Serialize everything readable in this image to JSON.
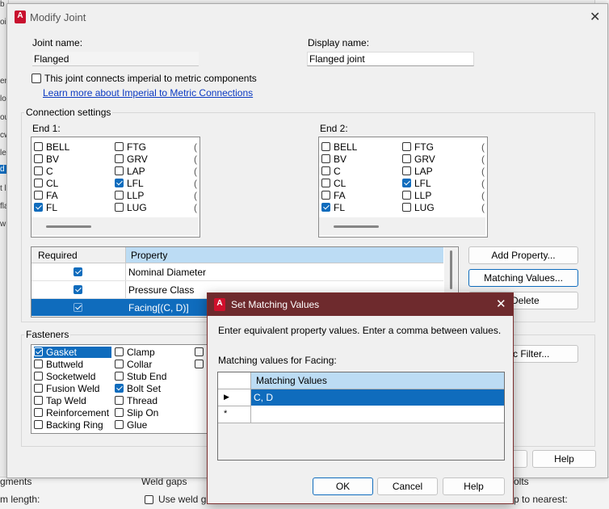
{
  "background": {
    "left_fragments": [
      "b",
      "oi",
      "er",
      "lo",
      "ou",
      "cw",
      "le",
      "d",
      "t l",
      "fla",
      "w"
    ],
    "bottom_texts": [
      "gments",
      "m length:",
      "Weld gaps",
      "Use weld ga",
      "olts",
      "p to nearest:"
    ]
  },
  "dialog": {
    "title": "Modify Joint",
    "joint_name_label": "Joint name:",
    "joint_name_value": "Flanged",
    "display_name_label": "Display name:",
    "display_name_value": "Flanged joint",
    "imperial_metric_label": "This joint connects imperial to metric components",
    "imperial_metric_checked": false,
    "learn_more_link": "Learn more about Imperial to Metric Connections",
    "connection_settings_title": "Connection settings",
    "end1_label": "End 1:",
    "end2_label": "End 2:",
    "end1_items": [
      {
        "label": "BELL",
        "checked": false
      },
      {
        "label": "BV",
        "checked": false
      },
      {
        "label": "C",
        "checked": false
      },
      {
        "label": "CL",
        "checked": false
      },
      {
        "label": "FA",
        "checked": false
      },
      {
        "label": "FL",
        "checked": true
      },
      {
        "label": "FTG",
        "checked": false
      },
      {
        "label": "GRV",
        "checked": false
      },
      {
        "label": "LAP",
        "checked": false
      },
      {
        "label": "LFL",
        "checked": true
      },
      {
        "label": "LLP",
        "checked": false
      },
      {
        "label": "LUG",
        "checked": false
      }
    ],
    "end2_items": [
      {
        "label": "BELL",
        "checked": false
      },
      {
        "label": "BV",
        "checked": false
      },
      {
        "label": "C",
        "checked": false
      },
      {
        "label": "CL",
        "checked": false
      },
      {
        "label": "FA",
        "checked": false
      },
      {
        "label": "FL",
        "checked": true
      },
      {
        "label": "FTG",
        "checked": false
      },
      {
        "label": "GRV",
        "checked": false
      },
      {
        "label": "LAP",
        "checked": false
      },
      {
        "label": "LFL",
        "checked": true
      },
      {
        "label": "LLP",
        "checked": false
      },
      {
        "label": "LUG",
        "checked": false
      }
    ],
    "property_grid": {
      "columns": [
        "Required",
        "Property"
      ],
      "rows": [
        {
          "required": true,
          "property": "Nominal Diameter"
        },
        {
          "required": true,
          "property": "Pressure Class"
        },
        {
          "required": true,
          "property": "Facing[(C, D)]"
        }
      ]
    },
    "buttons": {
      "add_property": "Add Property...",
      "matching_values": "Matching Values...",
      "delete": "Delete",
      "filter": "c Filter...",
      "help": "Help"
    },
    "fasteners_title": "Fasteners",
    "fasteners": [
      {
        "label": "Gasket",
        "checked": true
      },
      {
        "label": "Buttweld",
        "checked": false
      },
      {
        "label": "Socketweld",
        "checked": false
      },
      {
        "label": "Fusion Weld",
        "checked": false
      },
      {
        "label": "Tap Weld",
        "checked": false
      },
      {
        "label": "Reinforcement R",
        "checked": false
      },
      {
        "label": "Backing Ring",
        "checked": false
      },
      {
        "label": "Clamp",
        "checked": false
      },
      {
        "label": "Collar",
        "checked": false
      },
      {
        "label": "Stub End",
        "checked": false
      },
      {
        "label": "Bolt Set",
        "checked": true
      },
      {
        "label": "Thread",
        "checked": false
      },
      {
        "label": "Slip On",
        "checked": false
      },
      {
        "label": "Glue",
        "checked": false
      }
    ]
  },
  "modal": {
    "title": "Set Matching Values",
    "instruction": "Enter equivalent property values. Enter a comma between values.",
    "matching_label": "Matching values for Facing:",
    "column": "Matching Values",
    "rows": [
      "C, D",
      ""
    ],
    "ok": "OK",
    "cancel": "Cancel",
    "help": "Help"
  },
  "colors": {
    "accent": "#0f6cbd",
    "modal_titlebar": "#6e2a2d",
    "link": "#0a39c2"
  }
}
